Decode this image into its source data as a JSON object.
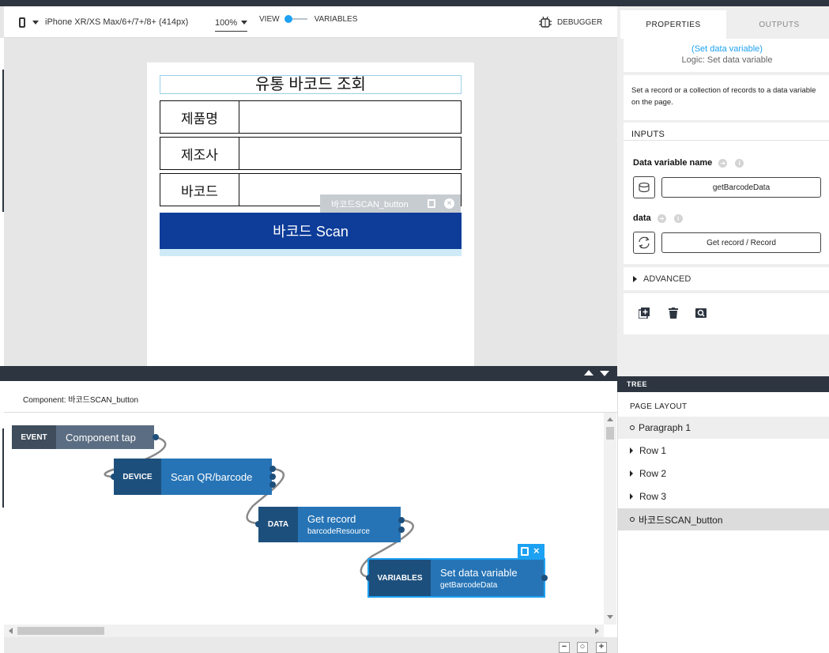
{
  "toolbar": {
    "device": "iPhone XR/XS Max/6+/7+/8+ (414px)",
    "zoom": "100%",
    "view_label": "VIEW",
    "variables_label": "VARIABLES",
    "debugger_label": "DEBUGGER"
  },
  "phone": {
    "title": "유통 바코드 조회",
    "rows": [
      {
        "label": "제품명"
      },
      {
        "label": "제조사"
      },
      {
        "label": "바코드"
      }
    ],
    "selected_tag": "바코드SCAN_button",
    "scan_button": "바코드 Scan"
  },
  "logic": {
    "component_title": "Component: 바코드SCAN_button",
    "blocks": [
      {
        "tag": "EVENT",
        "main": "Component tap",
        "sub": ""
      },
      {
        "tag": "DEVICE",
        "main": "Scan QR/barcode",
        "sub": ""
      },
      {
        "tag": "DATA",
        "main": "Get record",
        "sub": "barcodeResource"
      },
      {
        "tag": "VARIABLES",
        "main": "Set data variable",
        "sub": "getBarcodeData"
      }
    ]
  },
  "properties": {
    "tabs": [
      "PROPERTIES",
      "OUTPUTS"
    ],
    "logic_link": "(Set data variable)",
    "logic_sub": "Logic: Set data variable",
    "description": "Set a record or a collection of records to a data variable on the page.",
    "inputs_title": "INPUTS",
    "fields": [
      {
        "label": "Data variable name",
        "value": "getBarcodeData"
      },
      {
        "label": "data",
        "value": "Get record / Record"
      }
    ],
    "advanced": "ADVANCED"
  },
  "tree": {
    "title": "TREE",
    "section": "PAGE LAYOUT",
    "items": [
      {
        "label": "Paragraph 1"
      },
      {
        "label": "Row 1"
      },
      {
        "label": "Row 2"
      },
      {
        "label": "Row 3"
      },
      {
        "label": "바코드SCAN_button"
      }
    ]
  },
  "colors": {
    "accent": "#1da1f2",
    "scan_button": "#0d3c99",
    "block_tag": "#1d4f7c",
    "block_body": "#2674b6",
    "dark_bar": "#2d3540"
  }
}
